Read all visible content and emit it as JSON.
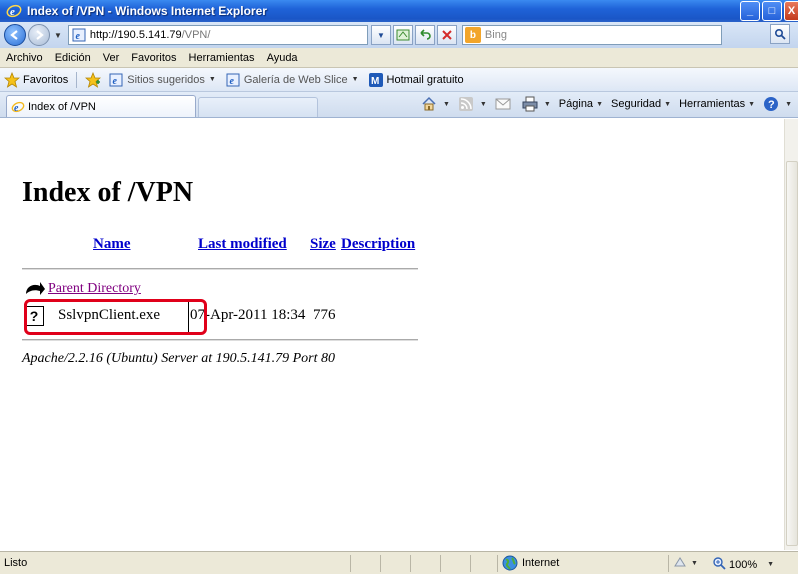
{
  "window": {
    "title": "Index of /VPN - Windows Internet Explorer",
    "minimize": "_",
    "maximize": "□",
    "close": "X"
  },
  "address": {
    "url_host": "http://190.5.141.79",
    "url_path": "/VPN/",
    "search_placeholder": "Bing"
  },
  "menu": {
    "items": [
      {
        "label": "Archivo"
      },
      {
        "label": "Edición"
      },
      {
        "label": "Ver"
      },
      {
        "label": "Favoritos"
      },
      {
        "label": "Herramientas"
      },
      {
        "label": "Ayuda"
      }
    ]
  },
  "favorites": {
    "label": "Favoritos",
    "links": [
      {
        "label": "Sitios sugeridos"
      },
      {
        "label": "Galería de Web Slice"
      },
      {
        "label": "Hotmail gratuito"
      }
    ]
  },
  "tab": {
    "label": "Index of /VPN"
  },
  "commands": {
    "page": "Página",
    "security": "Seguridad",
    "tools": "Herramientas"
  },
  "listing": {
    "title": "Index of /VPN",
    "columns": {
      "name": "Name",
      "last_modified": "Last modified",
      "size": "Size",
      "description": "Description"
    },
    "parent": "Parent Directory",
    "files": [
      {
        "icon": "?",
        "name": "SslvpnClient.exe",
        "modified": "07-Apr-2011 18:34",
        "size": "776"
      }
    ],
    "server_signature": "Apache/2.2.16 (Ubuntu) Server at 190.5.141.79 Port 80"
  },
  "status": {
    "text": "Listo",
    "zone": "Internet",
    "zoom": "100%"
  },
  "colors": {
    "titlebar": "#1f63d8",
    "link": "#0000cc",
    "visited": "#800080",
    "highlight": "#e0001a"
  }
}
